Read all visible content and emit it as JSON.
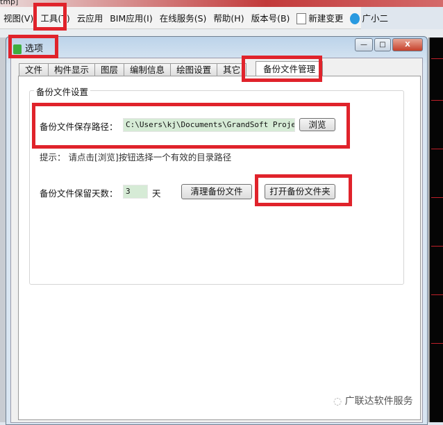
{
  "app": {
    "title_fragment": "tmp]"
  },
  "menubar": {
    "items": [
      "视图(V)",
      "工具(T)",
      "云应用",
      "BIM应用(I)",
      "在线服务(S)",
      "帮助(H)",
      "版本号(B)",
      "新建变更",
      "广小二"
    ]
  },
  "dialog": {
    "title": "选项",
    "tabs": [
      "文件",
      "构件显示",
      "图层",
      "编制信息",
      "绘图设置",
      "其它",
      "备份文件管理"
    ],
    "active_tab": "备份文件管理",
    "group_title": "备份文件设置",
    "path_label": "备份文件保存路径：",
    "path_value": "C:\\Users\\kj\\Documents\\GrandSoft Projects\\",
    "browse_label": "浏览",
    "hint": "提示：  请点击[浏览]按钮选择一个有效的目录路径",
    "days_label": "备份文件保留天数：",
    "days_value": "3",
    "days_unit": "天",
    "clean_label": "清理备份文件",
    "open_label": "打开备份文件夹"
  },
  "watermark": "广联达软件服务",
  "colors": {
    "highlight": "#e0232b",
    "field_bg": "#d6ebd6"
  }
}
